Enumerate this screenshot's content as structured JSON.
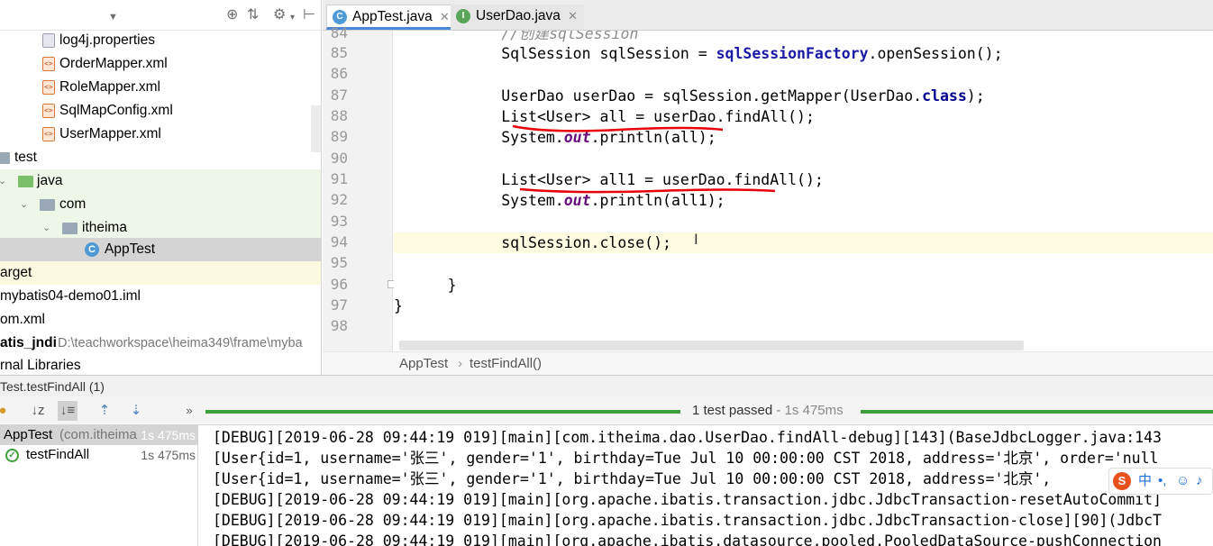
{
  "project": {
    "toolbar_icons": [
      "chevron-down-icon",
      "target-icon",
      "collapse-icon",
      "gear-icon",
      "hide-icon"
    ],
    "tree": [
      {
        "label": "log4j.properties",
        "type": "properties"
      },
      {
        "label": "OrderMapper.xml",
        "type": "xml"
      },
      {
        "label": "RoleMapper.xml",
        "type": "xml"
      },
      {
        "label": "SqlMapConfig.xml",
        "type": "xml"
      },
      {
        "label": "UserMapper.xml",
        "type": "xml"
      },
      {
        "label": "test",
        "type": "folder"
      },
      {
        "label": "java",
        "type": "folder-green"
      },
      {
        "label": "com",
        "type": "package"
      },
      {
        "label": "itheima",
        "type": "package"
      },
      {
        "label": "AppTest",
        "type": "class"
      },
      {
        "label": "arget",
        "type": "folder"
      },
      {
        "label": "mybatis04-demo01.iml",
        "type": "file"
      },
      {
        "label": "om.xml",
        "type": "file"
      },
      {
        "label": "atis_jndi",
        "type": "module",
        "path": "D:\\teachworkspace\\heima349\\frame\\myba"
      },
      {
        "label": "rnal Libraries",
        "type": "library"
      }
    ]
  },
  "editor": {
    "tabs": [
      {
        "label": "AppTest.java",
        "icon": "C",
        "active": true
      },
      {
        "label": "UserDao.java",
        "icon": "I",
        "active": false
      }
    ],
    "line_numbers": [
      "84",
      "85",
      "86",
      "87",
      "88",
      "89",
      "90",
      "91",
      "92",
      "93",
      "94",
      "95",
      "96",
      "97",
      "98"
    ],
    "code": {
      "l84": "            //创建sqlSession",
      "l85a": "            SqlSession sqlSession = ",
      "l85b": "sqlSessionFactory",
      "l85c": ".openSession();",
      "l87a": "            UserDao userDao = sqlSession.getMapper(UserDao.",
      "l87b": "class",
      "l87c": ");",
      "l88": "            List<User> all = userDao.findAll();",
      "l89a": "            System.",
      "l89b": "out",
      "l89c": ".println(all);",
      "l91": "            List<User> all1 = userDao.findAll();",
      "l92a": "            System.",
      "l92b": "out",
      "l92c": ".println(all1);",
      "l94": "            sqlSession.close();",
      "l96": "      }",
      "l97": "}"
    },
    "breadcrumb": [
      "AppTest",
      "testFindAll()"
    ]
  },
  "run": {
    "title": "Test.testFindAll (1)",
    "status": "1 test passed",
    "duration": "- 1s 475ms",
    "progress": 1.0,
    "tests": [
      {
        "label": "AppTest",
        "sub": "(com.itheima",
        "time": "1s 475ms"
      },
      {
        "label": "testFindAll",
        "time": "1s 475ms"
      }
    ],
    "console": [
      "[DEBUG][2019-06-28 09:44:19 019][main][com.itheima.dao.UserDao.findAll-debug][143](BaseJdbcLogger.java:143",
      "[User{id=1, username='张三', gender='1', birthday=Tue Jul 10 00:00:00 CST 2018, address='北京', order='null",
      "[User{id=1, username='张三', gender='1', birthday=Tue Jul 10 00:00:00 CST 2018, address='北京',",
      "[DEBUG][2019-06-28 09:44:19 019][main][org.apache.ibatis.transaction.jdbc.JdbcTransaction-resetAutoCommit]",
      "[DEBUG][2019-06-28 09:44:19 019][main][org.apache.ibatis.transaction.jdbc.JdbcTransaction-close][90](JdbcT",
      "[DEBUG][2019-06-28 09:44:19 019][main][org.apache.ibatis.datasource.pooled.PooledDataSource-pushConnection"
    ],
    "ime_label": "中"
  },
  "colors": {
    "accent": "#4a87d6",
    "pass": "#3c9f3c",
    "annotation": "#e8000b"
  }
}
